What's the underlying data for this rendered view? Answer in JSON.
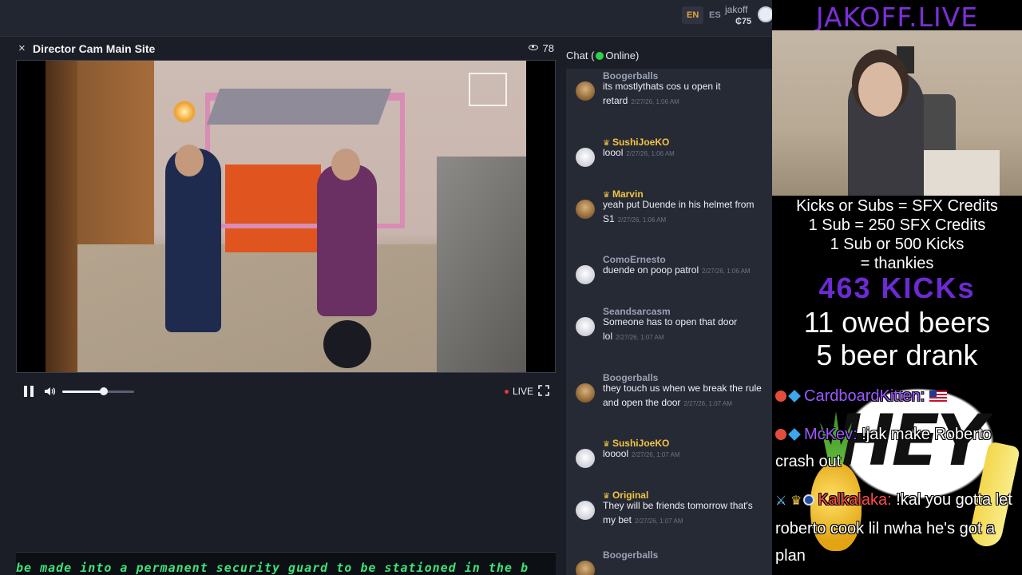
{
  "topbar": {
    "lang_en": "EN",
    "lang_es": "ES",
    "username": "jakoff",
    "coins": "₵75"
  },
  "player": {
    "close": "×",
    "title": "Director Cam Main Site",
    "viewers": "78",
    "live_label": "LIVE",
    "volume_fraction": 0.58
  },
  "ticker": {
    "text": "be made into a permanent security guard to be stationed in the b"
  },
  "chat": {
    "header_prefix": "Chat (",
    "header_status": "Online)",
    "messages": [
      {
        "user": "Boogerballs",
        "vip": false,
        "avatar": "brown",
        "text": "its mostlythats cos u open it retard",
        "time": "2/27/26, 1:06 AM"
      },
      {
        "user": "SushiJoeKO",
        "vip": true,
        "avatar": "white",
        "text": "loool",
        "time": "2/27/26, 1:06 AM"
      },
      {
        "user": "Marvin",
        "vip": true,
        "avatar": "brown",
        "text": "yeah put Duende in his helmet from S1",
        "time": "2/27/26, 1:06 AM"
      },
      {
        "user": "ComoErnesto",
        "vip": false,
        "avatar": "white",
        "text": "duende on poop patrol",
        "time": "2/27/26, 1:06 AM"
      },
      {
        "user": "Seandsarcasm",
        "vip": false,
        "avatar": "white",
        "text": "Someone has to open that door lol",
        "time": "2/27/26, 1:07 AM"
      },
      {
        "user": "Boogerballs",
        "vip": false,
        "avatar": "brown",
        "text": "they touch us when we break the rule and open the door",
        "time": "2/27/26, 1:07 AM"
      },
      {
        "user": "SushiJoeKO",
        "vip": true,
        "avatar": "white",
        "text": "looool",
        "time": "2/27/26, 1:07 AM"
      },
      {
        "user": "Original",
        "vip": true,
        "avatar": "white",
        "text": "They will be friends tomorrow that's my bet",
        "time": "2/27/26, 1:07 AM"
      },
      {
        "user": "Boogerballs",
        "vip": false,
        "avatar": "brown",
        "text": "",
        "time": ""
      }
    ]
  },
  "overlay": {
    "title": "JAKOFF.LIVE",
    "line1": "Kicks or Subs = SFX Credits",
    "line2": "1 Sub = 250 SFX Credits",
    "line3": "1 Sub or 500 Kicks",
    "line4": "= thankies",
    "kicks": "463 KICKs",
    "beers_owed": "11 owed beers",
    "beers_drank": "5 beer drank",
    "bg_word": "HEY",
    "chat": [
      {
        "name": "CardboardKitten:",
        "text": ""
      },
      {
        "name": "McKev:",
        "text": "!jak make Roberto crash out"
      },
      {
        "name": "Kalkalaka:",
        "text": "!kal you gotta let roberto cook lil nwha he's got a plan"
      }
    ]
  }
}
